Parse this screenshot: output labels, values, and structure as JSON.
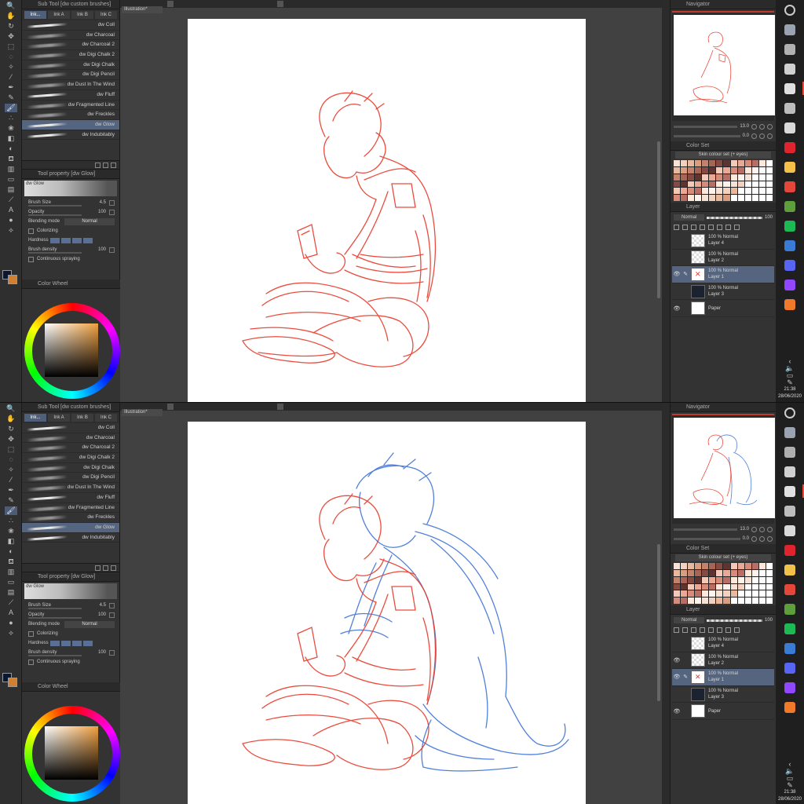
{
  "subtool_panel": {
    "title": "Sub Tool [dw custom brushes]",
    "tabs": [
      "Ink...",
      "Ink A",
      "Ink B",
      "Ink C"
    ],
    "brushes": [
      "dw Coll",
      "dw Charcoal",
      "dw Charcoal 2",
      "dw Digi Chalk 2",
      "dw Digi Chalk",
      "dw Digi Pencil",
      "dw Dust In The Wind",
      "dw Fluff",
      "dw Fragmented Line",
      "dw Freckles",
      "dw Glow",
      "dw Indubitably"
    ],
    "active_brush": "dw Glow"
  },
  "tool_property": {
    "title": "Tool property [dw Glow]",
    "preview_label": "dw Glow",
    "brush_size_label": "Brush Size",
    "brush_size": "4.5",
    "opacity_label": "Opacity",
    "opacity": "100",
    "blending_label": "Blending mode",
    "blending_value": "Normal",
    "colorizing_label": "Colorizing",
    "hardness_label": "Hardness",
    "density_label": "Brush density",
    "density": "100",
    "spraying_label": "Continuous spraying"
  },
  "color_wheel": {
    "title": "Color Wheel"
  },
  "document": {
    "tab": "Illustration*"
  },
  "navigator": {
    "title": "Navigator",
    "zoom": "13.0",
    "angle": "0.0"
  },
  "color_set": {
    "title": "Color Set",
    "name": "Skin colour set (+ eyes)"
  },
  "layer_panel": {
    "title": "Layer",
    "blend": "Normal",
    "opacity": "100"
  },
  "screens": [
    {
      "layers": [
        {
          "mode": "100 % Normal",
          "name": "Layer 4",
          "thumb": "checker",
          "visible": false,
          "active": false
        },
        {
          "mode": "100 % Normal",
          "name": "Layer 2",
          "thumb": "checker",
          "visible": false,
          "active": false
        },
        {
          "mode": "100 % Normal",
          "name": "Layer 1",
          "thumb": "red",
          "visible": true,
          "active": true
        },
        {
          "mode": "100 % Normal",
          "name": "Layer 3",
          "thumb": "dark",
          "visible": false,
          "active": false
        },
        {
          "mode": "",
          "name": "Paper",
          "thumb": "paper",
          "visible": true,
          "active": false
        }
      ]
    },
    {
      "layers": [
        {
          "mode": "100 % Normal",
          "name": "Layer 4",
          "thumb": "checker",
          "visible": false,
          "active": false
        },
        {
          "mode": "100 % Normal",
          "name": "Layer 2",
          "thumb": "checker",
          "visible": true,
          "active": false
        },
        {
          "mode": "100 % Normal",
          "name": "Layer 1",
          "thumb": "red",
          "visible": true,
          "active": true
        },
        {
          "mode": "100 % Normal",
          "name": "Layer 3",
          "thumb": "dark",
          "visible": false,
          "active": false
        },
        {
          "mode": "",
          "name": "Paper",
          "thumb": "paper",
          "visible": true,
          "active": false
        }
      ]
    }
  ],
  "taskbar": {
    "time": "21:38",
    "date": "28/06/2020",
    "apps": [
      {
        "name": "search-icon",
        "color": "#cccccc"
      },
      {
        "name": "steam-icon",
        "color": "#9aa4b1"
      },
      {
        "name": "cube-icon",
        "color": "#b0b0b0"
      },
      {
        "name": "chat-icon",
        "color": "#d0d0d0"
      },
      {
        "name": "clip-studio-icon",
        "color": "#e0e0e0"
      },
      {
        "name": "printer-icon",
        "color": "#bdbdbd"
      },
      {
        "name": "file-icon",
        "color": "#d9d9d9"
      },
      {
        "name": "opera-icon",
        "color": "#e0242f"
      },
      {
        "name": "folder-icon",
        "color": "#f3c04a"
      },
      {
        "name": "chrome-icon",
        "color": "#e5463a"
      },
      {
        "name": "minecraft-icon",
        "color": "#5f9e3c"
      },
      {
        "name": "spotify-icon",
        "color": "#1db954"
      },
      {
        "name": "steam-blue-icon",
        "color": "#3a7bd5"
      },
      {
        "name": "discord-icon",
        "color": "#5865f2"
      },
      {
        "name": "twitch-icon",
        "color": "#9146ff"
      },
      {
        "name": "firefox-icon",
        "color": "#f07a2a"
      }
    ]
  },
  "colors": {
    "red_sketch": "#e8392a",
    "blue_sketch": "#3f73d6",
    "accent": "#56657f"
  }
}
